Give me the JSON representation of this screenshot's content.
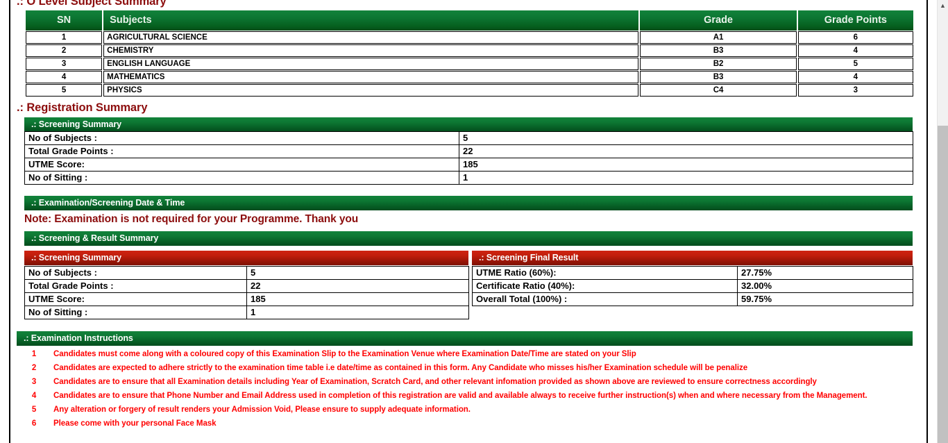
{
  "olevel": {
    "title": ".: O Level Subject Summary",
    "columns": [
      "SN",
      "Subjects",
      "Grade",
      "Grade Points"
    ],
    "rows": [
      {
        "sn": "1",
        "subject": "AGRICULTURAL SCIENCE",
        "grade": "A1",
        "points": "6"
      },
      {
        "sn": "2",
        "subject": "CHEMISTRY",
        "grade": "B3",
        "points": "4"
      },
      {
        "sn": "3",
        "subject": "ENGLISH LANGUAGE",
        "grade": "B2",
        "points": "5"
      },
      {
        "sn": "4",
        "subject": "MATHEMATICS",
        "grade": "B3",
        "points": "4"
      },
      {
        "sn": "5",
        "subject": "PHYSICS",
        "grade": "C4",
        "points": "3"
      }
    ]
  },
  "registration": {
    "title": ".: Registration Summary",
    "screening_bar": ".: Screening Summary",
    "rows": [
      {
        "label": "No of Subjects :",
        "value": "5"
      },
      {
        "label": "Total Grade Points :",
        "value": "22"
      },
      {
        "label": " UTME Score:",
        "value": "185"
      },
      {
        "label": "No of Sitting :",
        "value": "1"
      }
    ]
  },
  "exam_date": {
    "bar": ".: Examination/Screening Date & Time",
    "note": "Note: Examination is not required for your Programme. Thank you"
  },
  "screening_result": {
    "bar": ".: Screening & Result Summary",
    "left": {
      "header": ".: Screening Summary",
      "rows": [
        {
          "label": "No of Subjects :",
          "value": "5"
        },
        {
          "label": "Total Grade Points :",
          "value": "22"
        },
        {
          "label": "UTME Score:",
          "value": "185"
        },
        {
          "label": "No of Sitting :",
          "value": "1"
        }
      ]
    },
    "right": {
      "header": ".: Screening Final Result",
      "rows": [
        {
          "label": "UTME Ratio (60%):",
          "value": "27.75%"
        },
        {
          "label": "Certificate Ratio (40%):",
          "value": "32.00%"
        },
        {
          "label": "Overall Total (100%) :",
          "value": "59.75%"
        }
      ]
    }
  },
  "instructions": {
    "bar": ".: Examination Instructions",
    "items": [
      {
        "num": "1",
        "text": "Candidates must come along with a coloured copy of this Examination Slip to the Examination Venue where Examination Date/Time are stated on your Slip"
      },
      {
        "num": "2",
        "text": "Candidates are expected to adhere strictly to the examination time table i.e date/time as contained in this form. Any Candidate who misses his/her Examination schedule will be penalize"
      },
      {
        "num": "3",
        "text": "Candidates are to ensure that all Examination details including Year of Examination, Scratch Card, and other relevant infomation provided as shown above are reviewed to ensure correctness accordingly"
      },
      {
        "num": "4",
        "text": "Candidates are to ensure that Phone Number and Email Address used in completion of this registration are valid and available always to receive further instruction(s) when and where necessary from the Management."
      },
      {
        "num": "5",
        "text": "Any alteration or forgery of result renders your Admission Void, Please ensure to supply adequate information."
      },
      {
        "num": "6",
        "text": "Please come with your personal Face Mask"
      }
    ]
  },
  "scrollbar": {
    "up_arrow": "▲"
  },
  "colors": {
    "green_dark": "#065c24",
    "green_light": "#12833b",
    "red_dark": "#7e1104",
    "red_light": "#cf2412",
    "title_maroon": "#8c0d0d",
    "instruction_red": "#ff0000"
  }
}
